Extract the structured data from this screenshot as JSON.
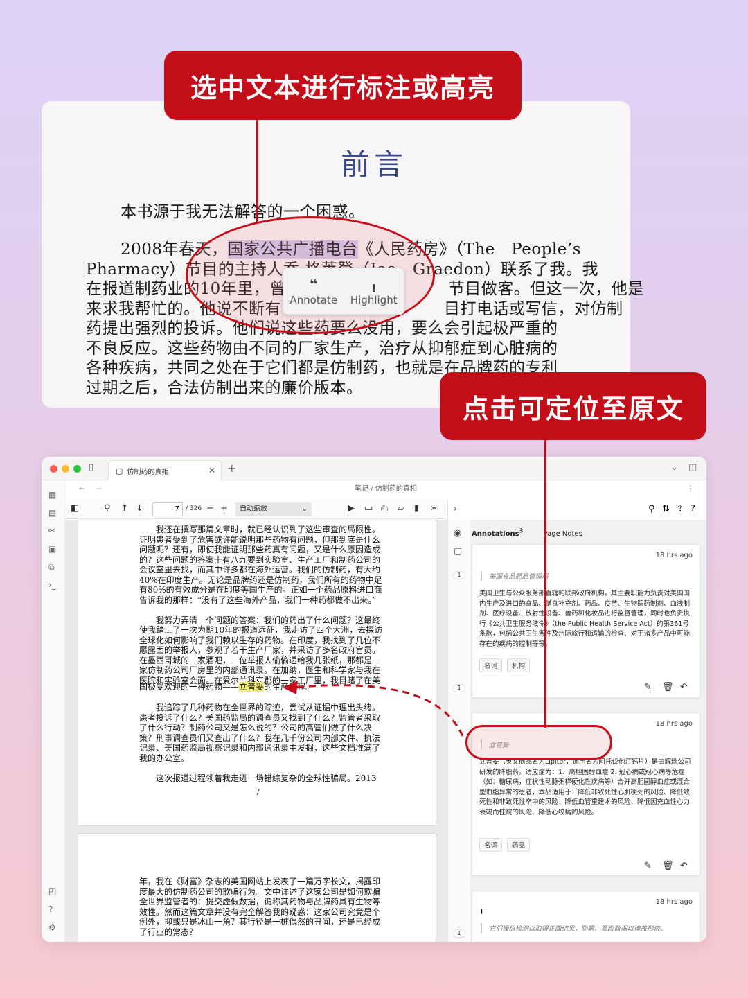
{
  "callouts": {
    "top": "选中文本进行标注或高亮",
    "right": "点击可定位至原文"
  },
  "book": {
    "title": "前言",
    "line1": "本书源于我无法解答的一个困惑。",
    "line2_a": "2008年春天，",
    "line2_hl": "国家公共广播电台",
    "line2_b": "《人民药房》（The　People’s",
    "line3": "Pharmacy）节目的主持人乔·格莱登（Joe　Graedon）联系了我。我",
    "line4": "在报道制药业的10年里，曾经　　　　　　　　　节目做客。但这一次，他是",
    "line5": "来求我帮忙的。他说不断有　　　　　　　　　　目打电话或写信，对仿制",
    "line6": "药提出强烈的投诉。他们说这些药要么没用，要么会引起极严重的",
    "line7": "不良反应。这些药物由不同的厂家生产，治疗从抑郁症到心脏病的",
    "line8": "各种疾病，共同之处在于它们都是仿制药，也就是在品牌药的专利",
    "line9": "过期之后，合法仿制出来的廉价版本。",
    "popup_annotate": "Annotate",
    "popup_highlight": "Highlight"
  },
  "app": {
    "tab_title": "仿制药的真相",
    "breadcrumb": "笔记 / 仿制药的真相",
    "page_current": "7",
    "page_total": "/ 326",
    "zoom": "自动缩放",
    "page_number": "7",
    "pdf_lines_page7": [
      "　　我还在撰写那篇文章时，就已经认识到了这些审查的局限性。",
      "证明患者受到了危害或许能说明那些药物有问题，但那到底是什么",
      "问题呢？还有，即使我能证明那些药真有问题，又是什么原因造成",
      "的？这些问题的答案十有八九要到实验室、生产工厂和制药公司的",
      "会议室里去找，而其中许多都在海外运营。我们的仿制药，有大约",
      "40%在印度生产。无论是品牌药还是仿制药，我们所有的药物中足",
      "有80%的有效成分是在印度等国生产的。正如一个药品原料进口商",
      "告诉我的那样：“没有了这些海外产品，我们一种药都做不出来。”",
      "",
      "　　我努力弄清一个问题的答案：我们的药出了什么问题？这最终",
      "使我踏上了一次为期10年的报道远征，我走访了四个大洲，去探访",
      "全球化如何影响了我们赖以生存的药物。在印度，我找到了几位不",
      "愿露面的举报人，参观了若干生产厂家，并采访了多名政府官员。",
      "在墨西哥城的一家酒吧，一位举报人偷偷递给我几张纸，那都是一",
      "家仿制药公司厂房里的内部通讯录。在加纳，医生和科学家与我在",
      "医院和实验室会面。在爱尔兰科克郡的一家工厂里，我目睹了在美"
    ],
    "pdf_line_hl_pre": "国极受欢迎的一种药物——",
    "pdf_line_hl": "立普妥",
    "pdf_line_hl_post": "的生产过程。",
    "pdf_lines_page7b": [
      "　　我追踪了几种药物在全世界的踪迹，尝试从证据中理出头绪。",
      "患者投诉了什么？美国药监局的调查员又找到了什么？监管者采取",
      "了什么行动？制药公司又是怎么说的？公司的高管们做了什么决",
      "策？刑事调查员们又查出了什么？我在几千份公司内部文件、执法",
      "记录、美国药监局视察记录和内部通讯录中发掘，这些文档堆满了",
      "我的办公室。",
      "",
      "　　这次报道过程领着我走进一场错综复杂的全球性骗局。2013"
    ],
    "pdf_lines_page8": [
      "年，我在《财富》杂志的美国网站上发表了一篇万字长文，揭露印",
      "度最大的仿制药公司的欺骗行为。文中详述了这家公司是如何欺骗",
      "全世界监管者的：提交虚假数据，诡称其药物与品牌药具有生物等",
      "效性。然而这篇文章并没有完全解答我的疑惑：这家公司究竟是个",
      "例外，抑或只是冰山一角？其行径是一桩偶然的丑闻，还是已经成",
      "了行业的常态？"
    ],
    "annotations_tab": "Annotations",
    "annotations_count": "3",
    "page_notes_tab": "Page Notes",
    "cards": [
      {
        "time": "18 hrs ago",
        "quote": "美国食品药品管理局",
        "body": "美国卫生与公众服务部直辖的联邦政府机构，其主要职能为负责对美国国内生产及进口的食品、膳食补充剂、药品、疫苗、生物医药制剂、血液制剂、医疗设备、放射性设备、兽药和化妆品进行监督管理，同时也负责执行《公共卫生服务法令》（the Public Health Service Act）的第361号条款，包括公共卫生条件及州际旅行和运输的检查、对于诸多产品中可能存在的疾病的控制等等。",
        "tags": [
          "名词",
          "机构"
        ],
        "badge": "1"
      },
      {
        "time": "18 hrs ago",
        "quote": "立普妥",
        "body": "立普妥（英文商品名为Lipitor，通用名为阿托伐他汀钙片）是由辉瑞公司研发的降脂药。适应症为：1、高胆固醇血症 2. 冠心病或冠心病等危症（如：糖尿病，症状性动脉粥样硬化性疾病等）合并高胆固醇血症或混合型血脂异常的患者，本品适用于：降低非致死性心肌梗死的风险、降低致死性和非致死性卒中的风险、降低血管重建术的风险、降低因充血性心力衰竭而住院的风险、降低心绞痛的风险。",
        "tags": [
          "名词",
          "药品"
        ],
        "badge": "1"
      },
      {
        "time": "18 hrs ago",
        "quote": "它们操纵检测以取得正面结果，隐瞒、篡改数据以掩盖形迹。",
        "badge": "1"
      }
    ]
  },
  "colors": {
    "accent_red": "#c30d19",
    "highlight_purple": "#cfc8f0",
    "highlight_yellow": "#f4f07a"
  }
}
